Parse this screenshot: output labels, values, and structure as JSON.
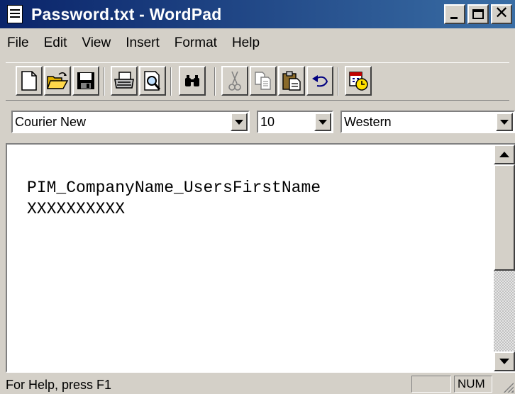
{
  "window": {
    "title": "Password.txt - WordPad"
  },
  "menu": {
    "items": [
      "File",
      "Edit",
      "View",
      "Insert",
      "Format",
      "Help"
    ]
  },
  "toolbar": {
    "icons": [
      "new-document-icon",
      "open-folder-icon",
      "save-disk-icon",
      "print-icon",
      "print-preview-icon",
      "find-binoculars-icon",
      "cut-scissors-icon",
      "copy-icon",
      "paste-icon",
      "undo-icon",
      "date-time-icon"
    ]
  },
  "format_bar": {
    "font_name": "Courier New",
    "font_size": "10",
    "script": "Western"
  },
  "document": {
    "lines": [
      "PIM_CompanyName_UsersFirstName",
      "XXXXXXXXXX"
    ]
  },
  "status_bar": {
    "help_text": "For Help, press F1",
    "num_indicator": "NUM"
  },
  "colors": {
    "title_bar_start": "#0a246a",
    "title_bar_end": "#3a6ea5",
    "chrome": "#d4d0c8"
  }
}
